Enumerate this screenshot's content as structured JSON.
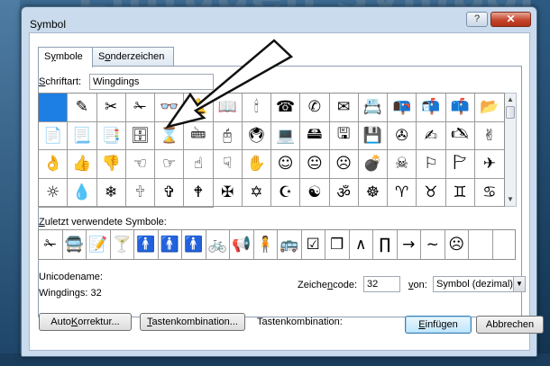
{
  "background": {
    "text": "Einfügen Symbol"
  },
  "window": {
    "title": "Symbol",
    "help_label": "?",
    "close_label": "✕"
  },
  "tabs": [
    {
      "key": "y",
      "prefix": "S",
      "rest": "mbole",
      "full": "Symbole"
    },
    {
      "key": "o",
      "prefix": "S",
      "rest": "nderzeichen",
      "full": "Sonderzeichen"
    }
  ],
  "font": {
    "label_key": "S",
    "label_rest": "chriftart:",
    "value": "Wingdings"
  },
  "symbol_grid": {
    "selected_index": 0,
    "cells": [
      " ",
      "✎",
      "✂",
      "✁",
      "👓",
      "🔔",
      "📖",
      "🕯",
      "☎",
      "✆",
      "✉",
      "📇",
      "📭",
      "📬",
      "📫",
      "📂",
      "📄",
      "📃",
      "📑",
      "🗄",
      "⌛",
      "🖮",
      "🖰",
      "🖲",
      "💻",
      "🖴",
      "🖫",
      "💾",
      "✇",
      "✍",
      "🖎",
      "✌",
      "👌",
      "👍",
      "👎",
      "☜",
      "☞",
      "☝",
      "☟",
      "✋",
      "☺",
      "😐",
      "☹",
      "💣",
      "☠",
      "⚐",
      "🏱",
      "✈",
      "☼",
      "💧",
      "❄",
      "🕆",
      "✞",
      "🕈",
      "✠",
      "✡",
      "☪",
      "☯",
      "ॐ",
      "☸",
      "♈",
      "♉",
      "♊",
      "♋",
      "♌",
      "♍",
      "♎",
      "♏",
      "♐",
      "♑"
    ]
  },
  "recent": {
    "label_key": "Z",
    "label_rest": "uletzt verwendete Symbole:",
    "symbols": [
      "✁",
      "🚍",
      "📝",
      "🍸",
      "🚹",
      "🚹",
      "🚹",
      "🚲",
      "📢",
      "🧍",
      "🚌",
      "☑",
      "❒",
      "∧",
      "∏",
      "→",
      "~",
      "☹"
    ]
  },
  "unicode": {
    "name_label": "Unicodename:",
    "name_value": "Wingdings: 32"
  },
  "code": {
    "label_prefix": "Zeiche",
    "label_key": "n",
    "label_rest": "code:",
    "value": "32"
  },
  "from": {
    "label_key": "v",
    "label_rest": "on:",
    "value": "Symbol (dezimal)"
  },
  "buttons": {
    "autocorrect_prefix": "Auto",
    "autocorrect_key": "K",
    "autocorrect_rest": "orrektur...",
    "keys_key": "T",
    "keys_rest": "astenkombination...",
    "shortcut_label": "Tastenkombination:",
    "insert_key": "E",
    "insert_rest": "infügen",
    "cancel": "Abbrechen"
  },
  "colors": {
    "selected_cell": "#1d7fe4",
    "close_button": "#c4452d",
    "chrome": "#c9dbec"
  },
  "icons": {
    "arrow": "callout-arrow",
    "scroll_up": "scroll-up-icon",
    "scroll_down": "scroll-down-icon",
    "dropdown": "chevron-down-icon"
  }
}
